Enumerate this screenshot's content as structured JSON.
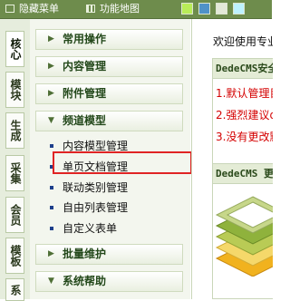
{
  "topbar": {
    "hide_menu_label": "隐藏菜单",
    "site_map_label": "功能地图",
    "color_swatches": [
      "#b9ec58",
      "#4f92c8",
      "#e3e9d8",
      "#bdf2ff"
    ]
  },
  "vtabs": [
    "核心",
    "模块",
    "生成",
    "采集",
    "会员",
    "模板",
    "系"
  ],
  "menu": {
    "groups": [
      {
        "label": "常用操作"
      },
      {
        "label": "内容管理"
      },
      {
        "label": "附件管理"
      },
      {
        "label": "频道模型"
      }
    ],
    "channel_items": [
      "内容模型管理",
      "单页文档管理",
      "联动类别管理",
      "自由列表管理",
      "自定义表单"
    ],
    "bottom_groups": [
      {
        "label": "批量维护"
      },
      {
        "label": "系统帮助"
      }
    ],
    "arrow_closed": "▶",
    "arrow_open": "▼"
  },
  "content": {
    "welcome": "欢迎使用专业",
    "panel1_title": "DedeCMS安全",
    "warnings": [
      "1.默认管理目",
      "2.强烈建议de",
      "3.没有更改默"
    ],
    "panel2_title": "DedeCMS 更"
  }
}
